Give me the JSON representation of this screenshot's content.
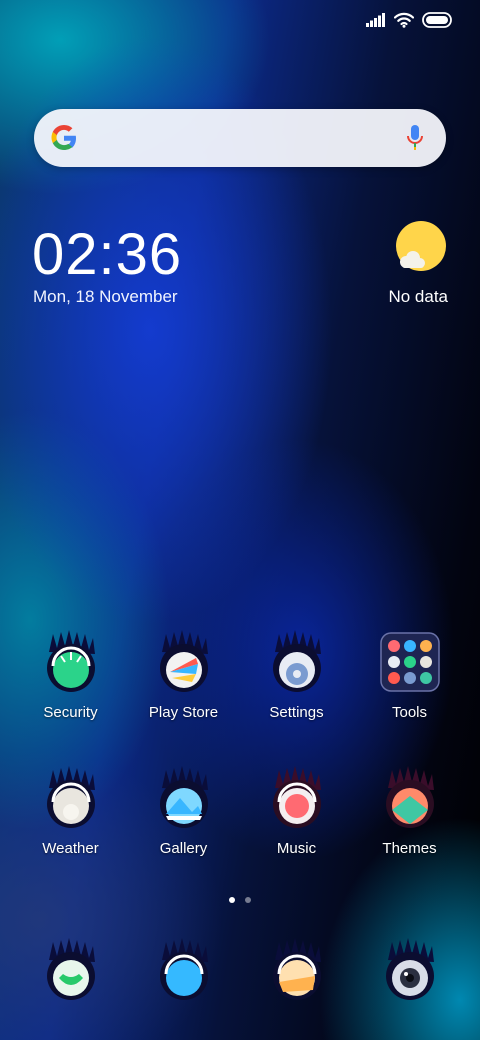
{
  "status_bar": {
    "signal_icon": "signal-bars-icon",
    "wifi_icon": "wifi-icon",
    "battery_icon": "battery-icon"
  },
  "search": {
    "logo_icon": "google-g-icon",
    "mic_icon": "microphone-icon"
  },
  "clock": {
    "time": "02:36",
    "date": "Mon, 18 November"
  },
  "weather": {
    "icon": "sun-cloud-icon",
    "text": "No data"
  },
  "apps": [
    {
      "label": "Security",
      "icon": "security-icon",
      "accent": "#2bd38a"
    },
    {
      "label": "Play Store",
      "icon": "play-store-icon",
      "accent": "#ff5a4f"
    },
    {
      "label": "Settings",
      "icon": "settings-icon",
      "accent": "#7a9bd0"
    },
    {
      "label": "Tools",
      "icon": "tools-folder-icon",
      "accent": "#3a4070"
    },
    {
      "label": "Weather",
      "icon": "weather-app-icon",
      "accent": "#e9e6df"
    },
    {
      "label": "Gallery",
      "icon": "gallery-icon",
      "accent": "#38b6ff"
    },
    {
      "label": "Music",
      "icon": "music-icon",
      "accent": "#ff6a72"
    },
    {
      "label": "Themes",
      "icon": "themes-icon",
      "accent": "#3ec7a3"
    }
  ],
  "pager": {
    "page_count": 2,
    "current_page": 1
  },
  "dock": [
    {
      "icon": "phone-icon",
      "accent": "#27c96a"
    },
    {
      "icon": "messages-icon",
      "accent": "#35b9ff"
    },
    {
      "icon": "browser-icon",
      "accent": "#ffb24f"
    },
    {
      "icon": "camera-icon",
      "accent": "#d8dde8"
    }
  ],
  "colors": {
    "search_bg": "#f5f7fc",
    "google_blue": "#4285F4",
    "google_red": "#EA4335",
    "google_yellow": "#FBBC05",
    "google_green": "#34A853",
    "weather_sun": "#ffd54a"
  }
}
